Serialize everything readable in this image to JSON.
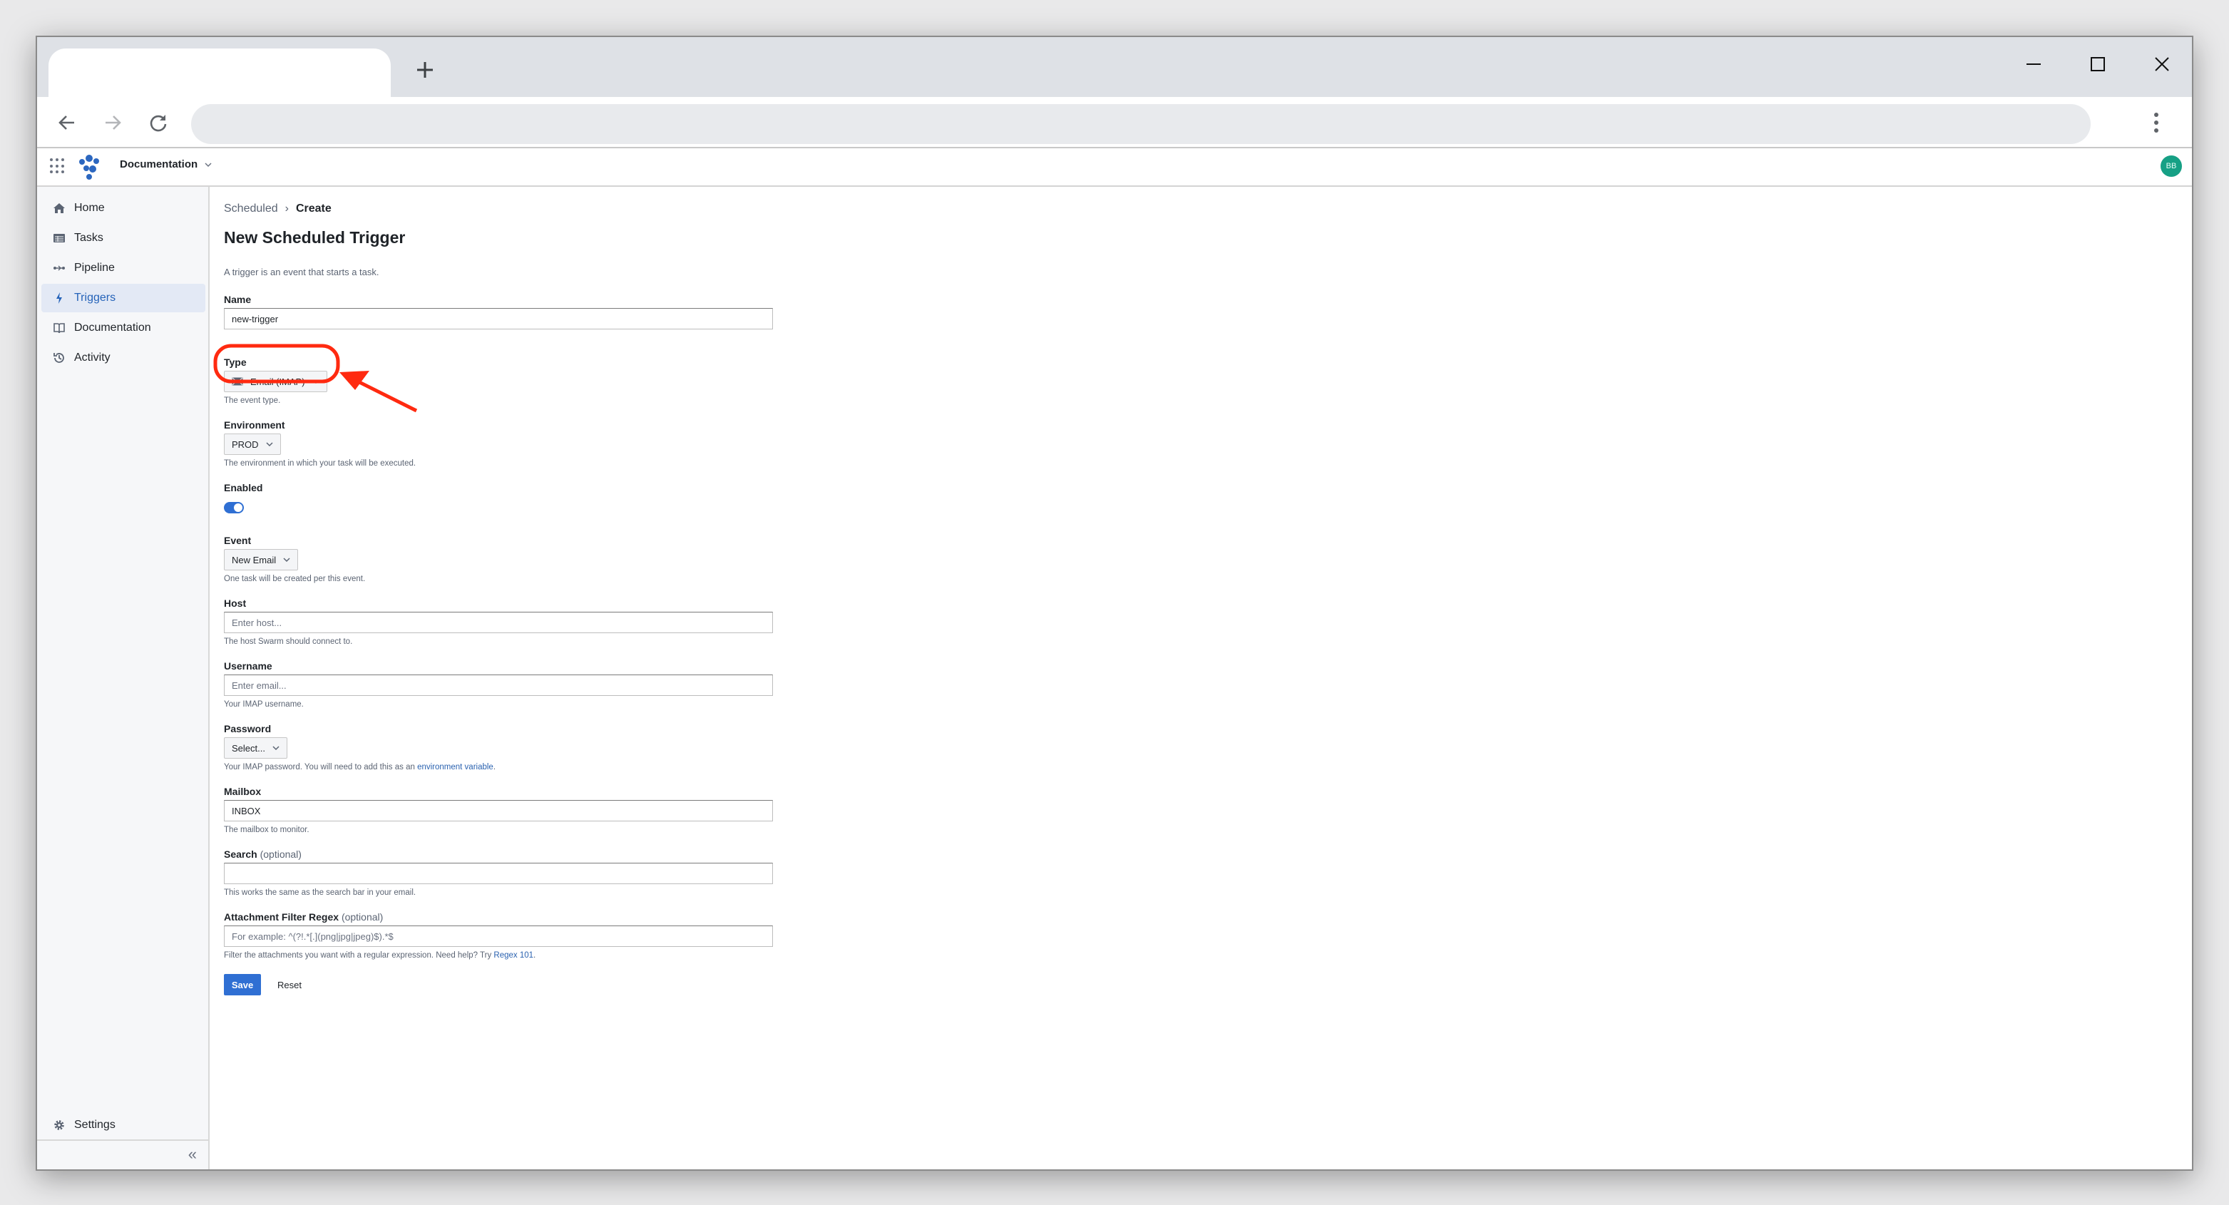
{
  "browser": {
    "tab_title": "",
    "new_tab_icon": "plus-icon",
    "window_controls": [
      "minimize-icon",
      "maximize-icon",
      "close-icon"
    ],
    "nav": [
      "back-arrow-icon",
      "forward-arrow-icon",
      "reload-icon"
    ],
    "address": "",
    "menu_icon": "kebab-menu-icon"
  },
  "app": {
    "apps_icon": "grid-icon",
    "logo_icon": "swarm-logo-icon",
    "project_name": "Documentation",
    "avatar_initials": "BB",
    "avatar_color": "#16a085",
    "accent_color": "#2f6fd3"
  },
  "sidebar": {
    "items": [
      {
        "label": "Home",
        "icon": "home-icon",
        "active": false
      },
      {
        "label": "Tasks",
        "icon": "table-icon",
        "active": false
      },
      {
        "label": "Pipeline",
        "icon": "pipeline-icon",
        "active": false
      },
      {
        "label": "Triggers",
        "icon": "bolt-icon",
        "active": true
      },
      {
        "label": "Documentation",
        "icon": "book-icon",
        "active": false
      },
      {
        "label": "Activity",
        "icon": "history-icon",
        "active": false
      }
    ],
    "settings_label": "Settings",
    "collapse_icon": "double-chevron-left-icon"
  },
  "page": {
    "breadcrumb": {
      "parent": "Scheduled",
      "current": "Create"
    },
    "title": "New Scheduled Trigger",
    "subtitle": "A trigger is an event that starts a task."
  },
  "form": {
    "name": {
      "label": "Name",
      "value": "new-trigger"
    },
    "type": {
      "label": "Type",
      "value": "Email (IMAP)",
      "icon": "envelope-icon",
      "help": "The event type."
    },
    "environment": {
      "label": "Environment",
      "value": "PROD",
      "help": "The environment in which your task will be executed."
    },
    "enabled": {
      "label": "Enabled",
      "value": true
    },
    "event": {
      "label": "Event",
      "value": "New Email",
      "help": "One task will be created per this event."
    },
    "host": {
      "label": "Host",
      "value": "",
      "placeholder": "Enter host...",
      "help": "The host Swarm should connect to."
    },
    "username": {
      "label": "Username",
      "value": "",
      "placeholder": "Enter email...",
      "help": "Your IMAP username."
    },
    "password": {
      "label": "Password",
      "value": "Select...",
      "help_prefix": "Your IMAP password. You will need to add this as an ",
      "help_link": "environment variable",
      "help_suffix": "."
    },
    "mailbox": {
      "label": "Mailbox",
      "value": "INBOX",
      "help": "The mailbox to monitor."
    },
    "search": {
      "label": "Search",
      "optional": "(optional)",
      "value": "",
      "placeholder": "",
      "help": "This works the same as the search bar in your email."
    },
    "attachment_regex": {
      "label": "Attachment Filter Regex",
      "optional": "(optional)",
      "value": "",
      "placeholder": "For example: ^(?!.*[.](png|jpg|jpeg)$).*$",
      "help_prefix": "Filter the attachments you want with a regular expression. Need help? Try ",
      "help_link": "Regex 101",
      "help_suffix": "."
    },
    "save_label": "Save",
    "reset_label": "Reset"
  },
  "annotation": {
    "shape": "rounded-rectangle highlight with arrow",
    "target": "type-select",
    "color": "#ff2a10"
  }
}
